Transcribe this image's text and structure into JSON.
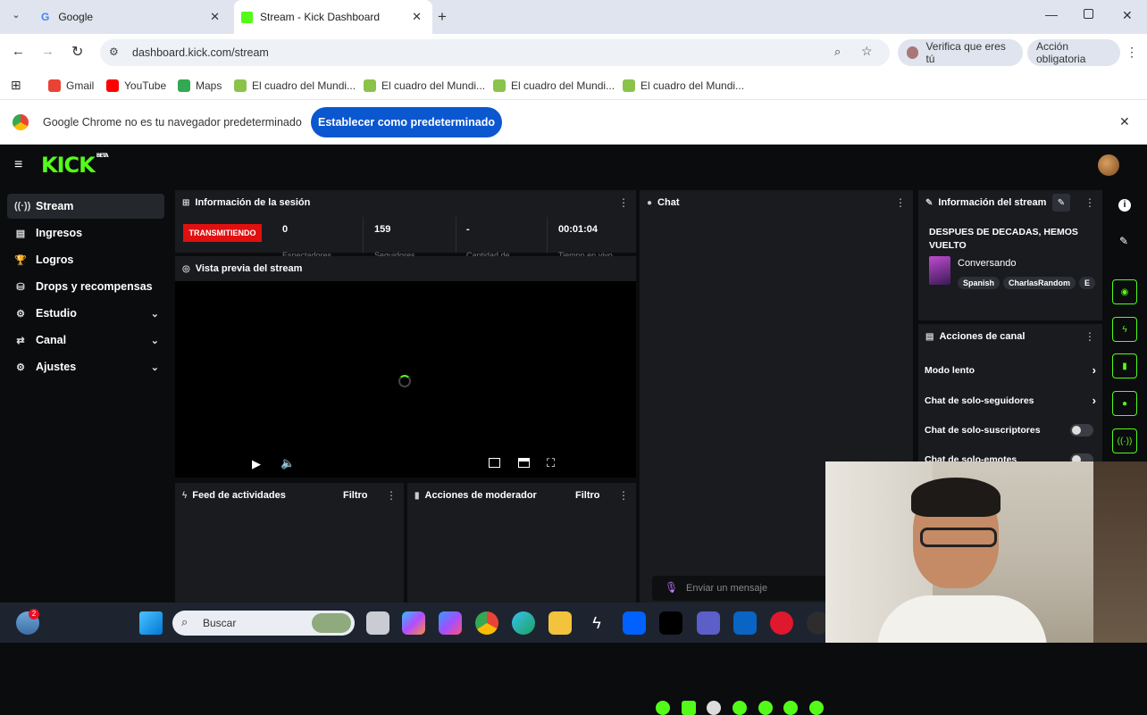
{
  "browser": {
    "tabs": [
      {
        "title": "Google"
      },
      {
        "title": "Stream - Kick Dashboard"
      }
    ],
    "url": "dashboard.kick.com/stream",
    "verify_label": "Verifica que eres tú",
    "action_label": "Acción obligatoria",
    "bookmarks": [
      "Gmail",
      "YouTube",
      "Maps",
      "El cuadro del Mundi...",
      "El cuadro del Mundi...",
      "El cuadro del Mundi...",
      "El cuadro del Mundi..."
    ],
    "infobar_text": "Google Chrome no es tu navegador predeterminado",
    "infobar_button": "Establecer como predeterminado"
  },
  "kick": {
    "logo": "KICK",
    "logo_badge": "BETA",
    "nav": [
      {
        "label": "Stream",
        "icon": "broadcast-icon",
        "glyph": "((·))",
        "active": true
      },
      {
        "label": "Ingresos",
        "icon": "revenue-icon",
        "glyph": "▤"
      },
      {
        "label": "Logros",
        "icon": "trophy-icon",
        "glyph": "🏆"
      },
      {
        "label": "Drops y recompensas",
        "icon": "drops-icon",
        "glyph": "⛁"
      },
      {
        "label": "Estudio",
        "icon": "studio-icon",
        "glyph": "⚙",
        "chevron": "⌄"
      },
      {
        "label": "Canal",
        "icon": "channel-icon",
        "glyph": "⇄",
        "chevron": "⌄"
      },
      {
        "label": "Ajustes",
        "icon": "settings-icon",
        "glyph": "⚙",
        "chevron": "⌄"
      }
    ],
    "session": {
      "title": "Información de la sesión",
      "status": "TRANSMITIENDO",
      "stats": [
        {
          "value": "0",
          "label": "Espectadores"
        },
        {
          "value": "159",
          "label": "Seguidores"
        },
        {
          "value": "-",
          "label": "Cantidad de"
        },
        {
          "value": "00:01:04",
          "label": "Tiempo en vivo"
        }
      ]
    },
    "preview": {
      "title": "Vista previa del stream"
    },
    "feed": {
      "title": "Feed de actividades",
      "filter": "Filtro"
    },
    "mod": {
      "title": "Acciones de moderador",
      "filter": "Filtro"
    },
    "chat": {
      "title": "Chat",
      "placeholder": "Enviar un mensaje"
    },
    "stream_info": {
      "title": "Información del stream",
      "stream_title": "DESPUES DE DECADAS, HEMOS VUELTO",
      "category": "Conversando",
      "tags": [
        "Spanish",
        "CharlasRandom",
        "E"
      ]
    },
    "channel_actions": {
      "title": "Acciones de canal",
      "items": [
        {
          "label": "Modo lento",
          "kind": "arrow"
        },
        {
          "label": "Chat de solo-seguidores",
          "kind": "arrow"
        },
        {
          "label": "Chat de solo-suscriptores",
          "kind": "toggle"
        },
        {
          "label": "Chat de solo-emotes",
          "kind": "toggle"
        }
      ]
    }
  },
  "taskbar": {
    "search_placeholder": "Buscar",
    "notification_count": "2"
  },
  "colors": {
    "kick_green": "#53fc18",
    "live_red": "#e10f0f",
    "chrome_blue": "#0b57d0"
  }
}
